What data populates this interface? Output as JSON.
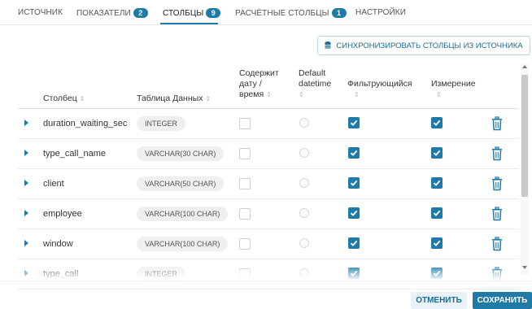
{
  "tabs": [
    {
      "label": "ИСТОЧНИК",
      "badge": null
    },
    {
      "label": "ПОКАЗАТЕЛИ",
      "badge": "2"
    },
    {
      "label": "СТОЛБЦЫ",
      "badge": "9"
    },
    {
      "label": "РАСЧЁТНЫЕ СТОЛБЦЫ",
      "badge": "1"
    },
    {
      "label": "НАСТРОЙКИ",
      "badge": null
    }
  ],
  "sync_button": "СИНХРОНИЗИРОВАТЬ СТОЛБЦЫ ИЗ ИСТОЧНИКА",
  "headers": {
    "column": "Столбец",
    "datatype": "Таблица Данных",
    "is_datetime_1": "Содержит",
    "is_datetime_2": "дату /",
    "is_datetime_3": "время",
    "default_datetime_1": "Default",
    "default_datetime_2": "datetime",
    "filterable": "Фильтрующийся",
    "dimension": "Измерение"
  },
  "rows": [
    {
      "name": "duration_waiting_sec",
      "type": "INTEGER"
    },
    {
      "name": "type_call_name",
      "type": "VARCHAR(30 CHAR)"
    },
    {
      "name": "client",
      "type": "VARCHAR(50 CHAR)"
    },
    {
      "name": "employee",
      "type": "VARCHAR(100 CHAR)"
    },
    {
      "name": "window",
      "type": "VARCHAR(100 CHAR)"
    },
    {
      "name": "type_call",
      "type": "INTEGER"
    }
  ],
  "footer": {
    "cancel": "ОТМЕНИТЬ",
    "save": "СОХРАНИТЬ"
  },
  "colors": {
    "accent": "#1f7aa8"
  }
}
